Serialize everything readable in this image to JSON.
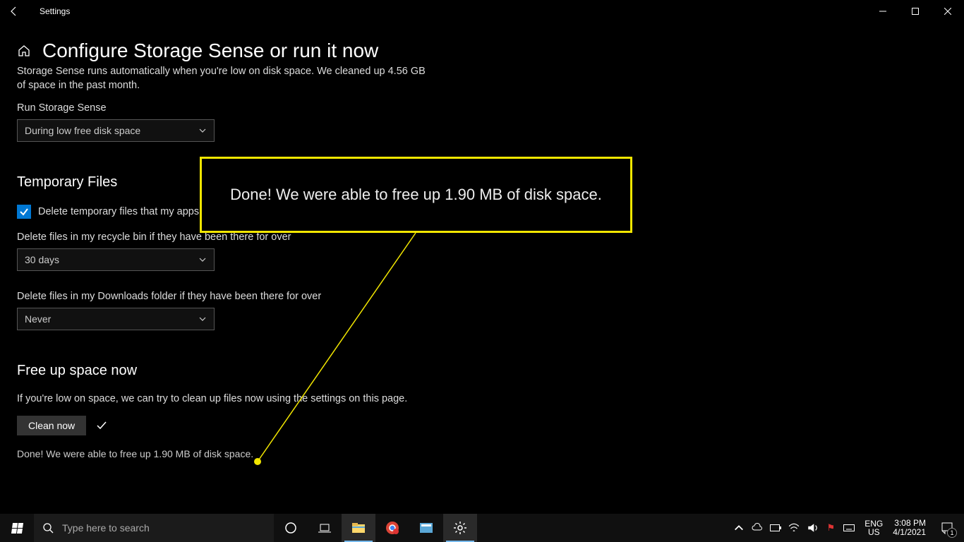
{
  "window": {
    "title": "Settings"
  },
  "page": {
    "title": "Configure Storage Sense or run it now",
    "intro": "Storage Sense runs automatically when you're low on disk space. We cleaned up 4.56 GB of space in the past month.",
    "run_label": "Run Storage Sense",
    "run_value": "During low free disk space"
  },
  "temp": {
    "heading": "Temporary Files",
    "checkbox_label": "Delete temporary files that my apps aren't using",
    "recycle_label": "Delete files in my recycle bin if they have been there for over",
    "recycle_value": "30 days",
    "downloads_label": "Delete files in my Downloads folder if they have been there for over",
    "downloads_value": "Never"
  },
  "free": {
    "heading": "Free up space now",
    "desc": "If you're low on space, we can try to clean up files now using the settings on this page.",
    "button": "Clean now",
    "result": "Done! We were able to free up 1.90 MB of disk space."
  },
  "callout": {
    "text": "Done! We were able to free up 1.90 MB of disk space."
  },
  "taskbar": {
    "search_placeholder": "Type here to search",
    "lang1": "ENG",
    "lang2": "US",
    "time": "3:08 PM",
    "date": "4/1/2021",
    "notif_count": "1"
  }
}
